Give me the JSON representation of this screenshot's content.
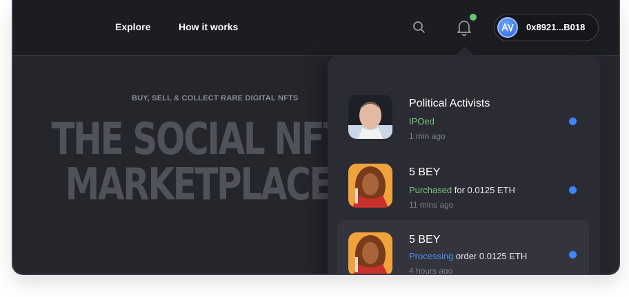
{
  "header": {
    "nav": [
      {
        "label": "Explore"
      },
      {
        "label": "How it works"
      }
    ],
    "search_icon": "search-icon",
    "notifications_icon": "bell-icon",
    "notification_indicator_color": "#6fc276",
    "wallet": {
      "address": "0x8921...B018",
      "avatar_icon": "avatar-logo-icon"
    }
  },
  "hero": {
    "subtitle": "BUY, SELL & COLLECT RARE DIGITAL NFTS",
    "title_line1": "THE SOCIAL NFT",
    "title_line2": "MARKETPLACE"
  },
  "notifications": [
    {
      "title": "Political Activists",
      "status": "IPOed",
      "detail": "",
      "time": "1 min ago",
      "status_color": "#7cc47f"
    },
    {
      "title": "5 BEY",
      "status": "Purchased",
      "detail": " for 0.0125 ETH",
      "time": "11 mins ago",
      "status_color": "#7cc47f"
    },
    {
      "title": "5 BEY",
      "status": "Processing",
      "detail": " order 0.0125 ETH",
      "time": "4 hours ago",
      "status_color": "#4a8df0"
    }
  ],
  "colors": {
    "background": "#25262c",
    "header": "#1c1d22",
    "panel": "#2b2c33",
    "unread_dot": "#3d86f5"
  }
}
